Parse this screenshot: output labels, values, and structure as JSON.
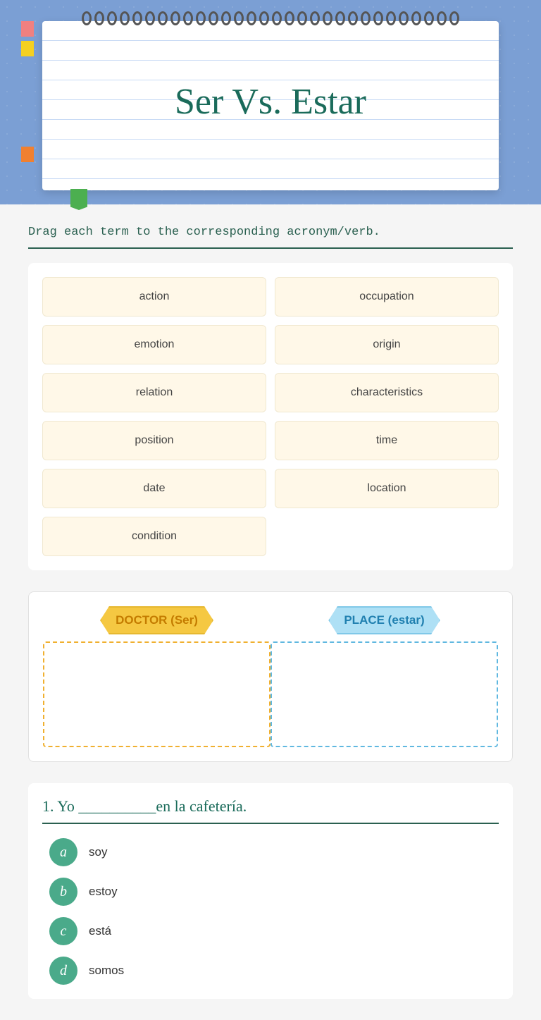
{
  "notebook": {
    "title": "Ser Vs. Estar"
  },
  "instruction": {
    "text": "Drag each term to the corresponding acronym/verb."
  },
  "terms": [
    {
      "id": "action",
      "label": "action"
    },
    {
      "id": "occupation",
      "label": "occupation"
    },
    {
      "id": "emotion",
      "label": "emotion"
    },
    {
      "id": "origin",
      "label": "origin"
    },
    {
      "id": "relation",
      "label": "relation"
    },
    {
      "id": "characteristics",
      "label": "characteristics"
    },
    {
      "id": "position",
      "label": "position"
    },
    {
      "id": "time",
      "label": "time"
    },
    {
      "id": "date",
      "label": "date"
    },
    {
      "id": "location",
      "label": "location"
    },
    {
      "id": "condition",
      "label": "condition"
    }
  ],
  "dropzones": {
    "doctor": {
      "label": "DOCTOR (Ser)"
    },
    "place": {
      "label": "PLACE (estar)"
    }
  },
  "quiz": {
    "question_number": "1.",
    "question_text": "Yo __________en la cafetería.",
    "options": [
      {
        "letter": "a",
        "text": "soy"
      },
      {
        "letter": "b",
        "text": "estoy"
      },
      {
        "letter": "c",
        "text": "está"
      },
      {
        "letter": "d",
        "text": "somos"
      }
    ]
  },
  "spirals": [
    1,
    2,
    3,
    4,
    5,
    6,
    7,
    8,
    9,
    10,
    11,
    12,
    13,
    14,
    15,
    16,
    17,
    18,
    19,
    20,
    21,
    22,
    23,
    24,
    25,
    26,
    27,
    28,
    29,
    30
  ]
}
